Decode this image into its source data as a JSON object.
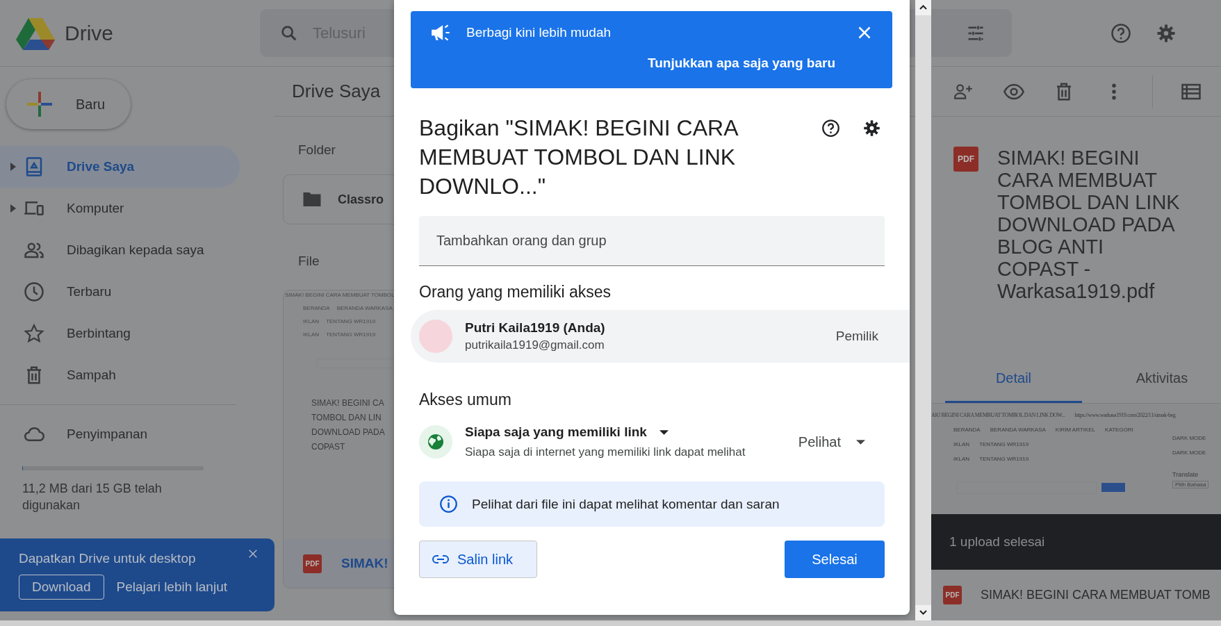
{
  "header": {
    "app_name": "Drive",
    "search": {
      "placeholder": "Telusuri"
    }
  },
  "sidebar": {
    "new_button": "Baru",
    "items": [
      {
        "label": "Drive Saya",
        "kind": "tree",
        "selected": true
      },
      {
        "label": "Komputer",
        "kind": "tree",
        "selected": false
      },
      {
        "label": "Dibagikan kepada saya",
        "kind": "link",
        "selected": false
      },
      {
        "label": "Terbaru",
        "kind": "link",
        "selected": false
      },
      {
        "label": "Berbintang",
        "kind": "link",
        "selected": false
      },
      {
        "label": "Sampah",
        "kind": "link",
        "selected": false
      }
    ],
    "storage": {
      "label": "Penyimpanan",
      "level": 0.001,
      "usage": "11,2 MB dari 15 GB telah digunakan"
    }
  },
  "desktop_banner": {
    "title": "Dapatkan Drive untuk desktop",
    "download": "Download",
    "learn_more": "Pelajari lebih lanjut"
  },
  "main": {
    "title": "Drive Saya",
    "folder_heading": "Folder",
    "folders": [
      {
        "name": "Classro"
      }
    ],
    "file_heading": "File",
    "files": [
      {
        "type": "PDF",
        "name": "SIMAK!",
        "preview": {
          "header": "SIMAK! BEGINI CARA MEMBUAT TOMBOL",
          "nav": [
            [
              "BERANDA",
              "BERANDA WARKASA"
            ],
            [
              "IKLAN",
              "TENTANG WR1919"
            ],
            [
              "IKLAN",
              "TENTANG WR1919"
            ]
          ],
          "title": [
            "SIMAK! BEGINI CA",
            "TOMBOL DAN LIN",
            "DOWNLOAD PADA",
            "COPAST"
          ]
        }
      }
    ]
  },
  "details": {
    "type": "PDF",
    "file_name": "SIMAK! BEGINI CARA MEMBUAT TOMBOL DAN LINK DOWNLOAD PADA BLOG ANTI COPAST - Warkasa1919.pdf",
    "tabs": [
      {
        "label": "Detail",
        "selected": true
      },
      {
        "label": "Aktivitas",
        "selected": false
      }
    ],
    "preview": {
      "title": "AK! BEGINI CARA MEMBUAT TOMBOL DAN LINK DOW...",
      "url": "https://www.warkasa1919.com/2022/11/simak-beg",
      "nav": [
        [
          "BERANDA",
          "BERANDA WARKASA",
          "KIRIM ARTIKEL",
          "KATEGORI"
        ],
        [
          "IKLAN",
          "TENTANG WR1919"
        ],
        [
          "IKLAN",
          "TENTANG WR1919"
        ]
      ],
      "side": [
        "DARK MODE",
        "DARK MODE"
      ],
      "translate": "Translate",
      "language_select": "Pilih Bahasa"
    }
  },
  "uploads": {
    "message": "1 upload selesai",
    "items": [
      {
        "type": "PDF",
        "name": "SIMAK! BEGINI CARA MEMBUAT TOMB"
      }
    ]
  },
  "share_dialog": {
    "announcement": {
      "text": "Berbagi kini lebih mudah",
      "link": "Tunjukkan apa saja yang baru"
    },
    "title": "Bagikan \"SIMAK! BEGINI CARA MEMBUAT TOMBOL DAN LINK DOWNLO...\"",
    "add_field": {
      "placeholder": "Tambahkan orang dan grup"
    },
    "people_heading": "Orang yang memiliki akses",
    "people": [
      {
        "name": "Putri Kaila1919 (Anda)",
        "email": "putrikaila1919@gmail.com",
        "role": "Pemilik"
      }
    ],
    "general_heading": "Akses umum",
    "general": {
      "scope": "Siapa saja yang memiliki link",
      "description": "Siapa saja di internet yang memiliki link dapat melihat",
      "role": "Pelihat"
    },
    "notice": "Pelihat dari file ini dapat melihat komentar dan saran",
    "copy_link": "Salin link",
    "done": "Selesai"
  }
}
